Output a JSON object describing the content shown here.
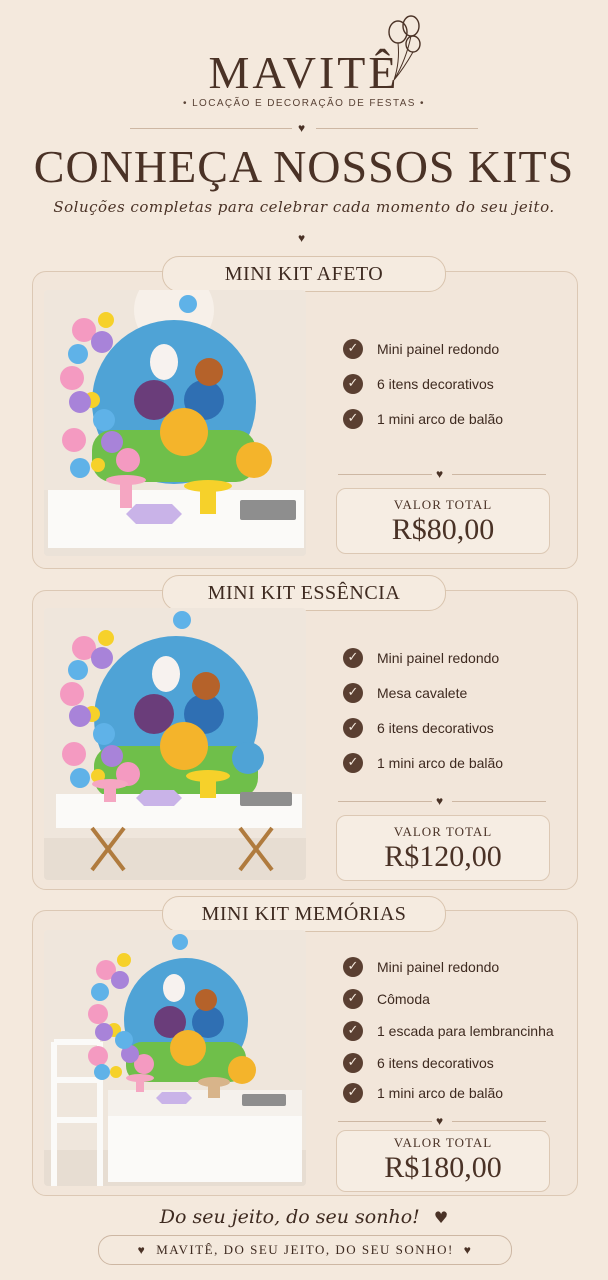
{
  "header": {
    "brand": "MAVITÊ",
    "tagline": "• LOCAÇÃO E DECORAÇÃO DE FESTAS •",
    "title": "CONHEÇA NOSSOS KITS",
    "subtitle": "Soluções completas para celebrar cada momento do seu jeito."
  },
  "kits": [
    {
      "title": "MINI KIT AFETO",
      "features": [
        "Mini painel redondo",
        "6 itens decorativos",
        "1 mini arco de balão"
      ],
      "price_label": "VALOR TOTAL",
      "price": "R$80,00"
    },
    {
      "title": "MINI KIT ESSÊNCIA",
      "features": [
        "Mini painel redondo",
        "Mesa cavalete",
        "6 itens decorativos",
        "1 mini arco de balão"
      ],
      "price_label": "VALOR TOTAL",
      "price": "R$120,00"
    },
    {
      "title": "MINI KIT MEMÓRIAS",
      "features": [
        "Mini painel redondo",
        "Cômoda",
        "1 escada para lembrancinha",
        "6 itens decorativos",
        "1 mini arco de balão"
      ],
      "price_label": "VALOR TOTAL",
      "price": "R$180,00"
    }
  ],
  "footer": {
    "script": "Do seu jeito, do seu sonho!",
    "pill": "MAVITÊ, DO SEU JEITO, DO SEU SONHO!"
  },
  "icons": {
    "check": "check-circle-icon",
    "heart": "heart-icon",
    "balloons": "balloons-icon"
  },
  "colors": {
    "background": "#f4e9dd",
    "text": "#4a3226",
    "accent": "#5a3f31"
  }
}
